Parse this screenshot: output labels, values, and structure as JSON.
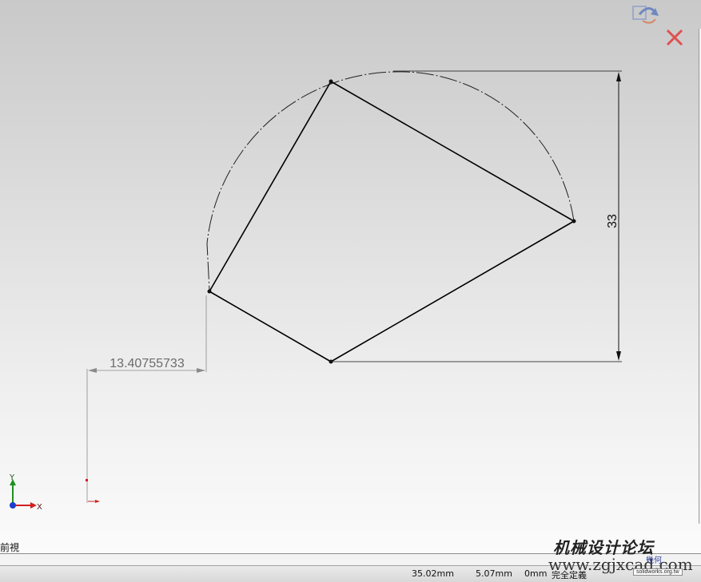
{
  "sketch": {
    "vertical_dimension": "33",
    "horizontal_dimension": "13.40755733",
    "axis_labels": {
      "x": "X",
      "y": "Y"
    }
  },
  "confirm_corner": {
    "ok_icon": "sketch-exit-icon",
    "cancel_icon": "cancel-x-icon",
    "cancel_color": "#e05050"
  },
  "view": {
    "label": "前視"
  },
  "statusbar": {
    "x_coord": "35.02mm",
    "y_coord": "5.07mm",
    "z_coord": "0mm",
    "status": "完全定義"
  },
  "watermark": {
    "title": "机械设计论坛",
    "url": "www.zgjxcad.com",
    "badge": "solidworks.org.tw",
    "mini": "幾何"
  },
  "colors": {
    "sketch_line": "#000000",
    "construction_arc": "#202020",
    "dimension": "#6b6b6b",
    "axis_x": "#d02020",
    "axis_y": "#209020",
    "axis_z": "#1a3fd0"
  }
}
